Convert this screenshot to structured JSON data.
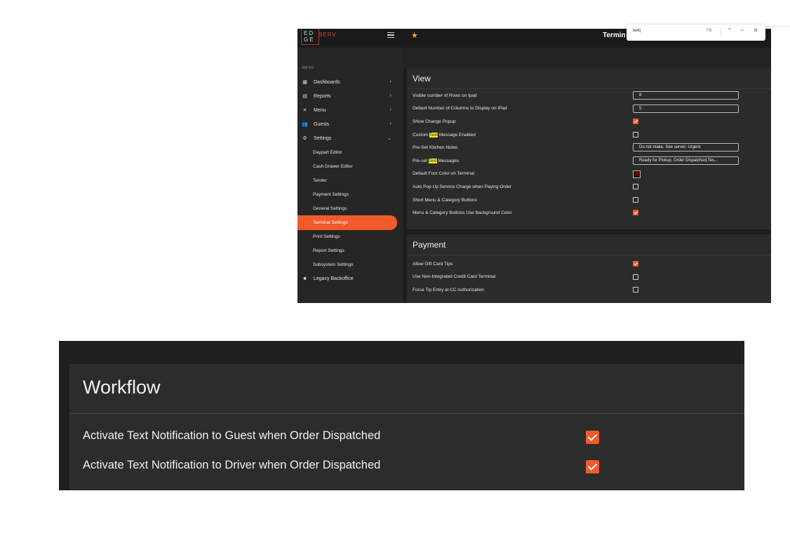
{
  "app": {
    "brand": {
      "logo_line1": "ED",
      "logo_line2": "GE",
      "logo_suffix": "SERV"
    },
    "page_title": "Termin",
    "menu_caption": "MENU",
    "nav": [
      {
        "label": "Dashboards",
        "icon": "dashboard-icon",
        "chevron": "›"
      },
      {
        "label": "Reports",
        "icon": "document-icon",
        "chevron": "›"
      },
      {
        "label": "Menu",
        "icon": "utensils-icon",
        "chevron": "›"
      },
      {
        "label": "Guests",
        "icon": "users-icon",
        "chevron": "›"
      },
      {
        "label": "Settings",
        "icon": "gear-icon",
        "chevron": "⌄"
      }
    ],
    "settings_sub": [
      "Daypart Editor",
      "Cash Drawer Editor",
      "Tender",
      "Payment Settings",
      "General Settings",
      "Terminal Settings",
      "Print Settings",
      "Report Settings",
      "Subsystem Settings"
    ],
    "legacy": {
      "label": "Legacy Backoffice",
      "icon": "briefcase-icon"
    },
    "view": {
      "title": "View",
      "rows": {
        "r1": {
          "label": "Visible number of Rows on Ipad",
          "value": "8"
        },
        "r2": {
          "label": "Default Number of Columns to Display on iPad",
          "value": "5"
        },
        "r3": {
          "label": "Show Change Popup"
        },
        "r4": {
          "before": "Custom ",
          "hl": "Text",
          "after": " Message Enabled"
        },
        "r5": {
          "label": "Pre-Set Kitchen Notes",
          "value": "Do not make, See server, Urgent"
        },
        "r6": {
          "before": "Pre-set ",
          "hl": "Text",
          "after": " Messages",
          "value": "Ready for Pickup, Order Dispatched,Tes..."
        },
        "r7": {
          "label": "Default Font Color on Terminal"
        },
        "r8": {
          "label": "Auto Pop Up Service Charge when Paying Order"
        },
        "r9": {
          "label": "Short Menu & Category Buttons"
        },
        "r10": {
          "label": "Menu & Category Buttons Use Background Color"
        }
      },
      "checked": {
        "r3": true,
        "r4": false,
        "r8": false,
        "r9": false,
        "r10": true
      }
    },
    "payment": {
      "title": "Payment",
      "rows": [
        {
          "label": "Allow Gift Card Tips",
          "checked": true
        },
        {
          "label": "Use Non-Integrated Credit Card Terminal",
          "checked": false
        },
        {
          "label": "Force Tip Entry at CC Authorization",
          "checked": false
        }
      ]
    },
    "colors": {
      "accent": "#f15a2b",
      "highlight": "#f7ea2a",
      "star": "#f4b400",
      "font_color_swatch": "#6b0000"
    }
  },
  "findbar": {
    "query": "text|",
    "count": "7/8",
    "prev_icon": "chevron-up-icon",
    "next_icon": "chevron-down-icon",
    "close_icon": "close-icon"
  },
  "workflow": {
    "title": "Workflow",
    "rows": [
      {
        "label": "Activate Text Notification to Guest when Order Dispatched",
        "checked": true
      },
      {
        "label": "Activate Text Notification to Driver when Order Dispatched",
        "checked": true
      }
    ]
  }
}
